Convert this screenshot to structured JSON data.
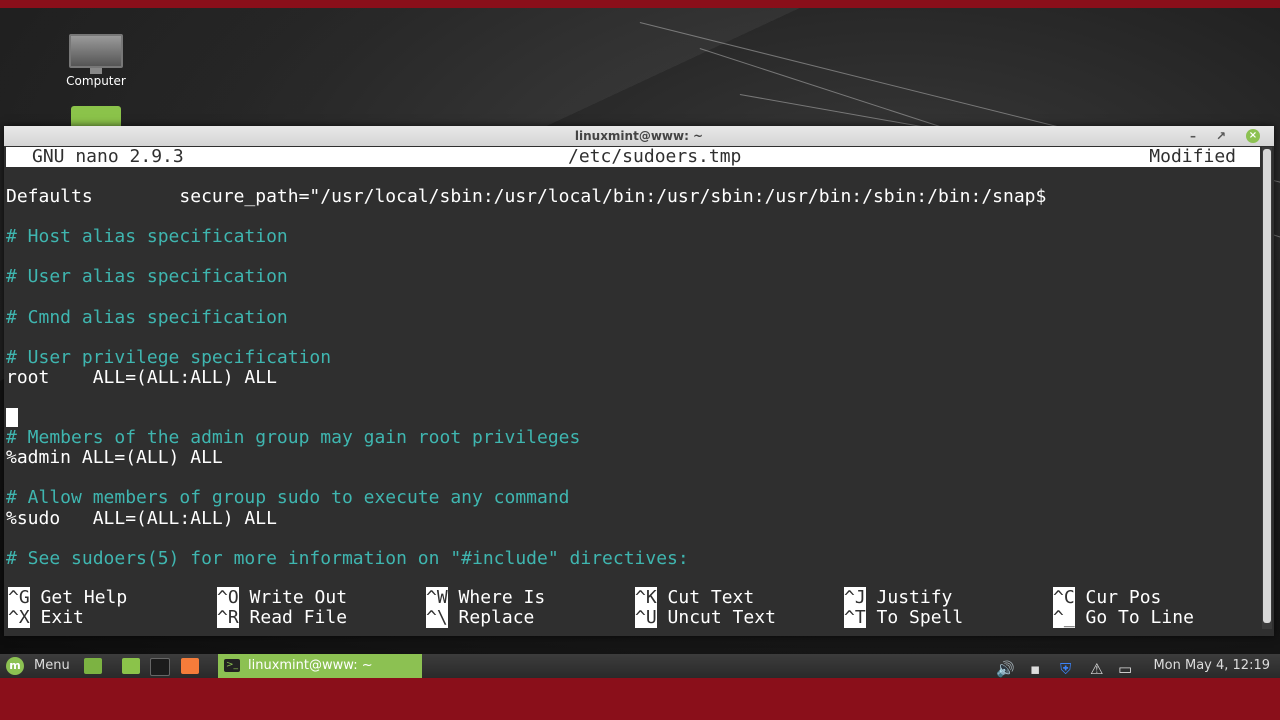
{
  "desktop": {
    "icons": [
      {
        "label": "Computer",
        "icon": "computer-icon"
      },
      {
        "label": "",
        "icon": "home-folder-icon"
      }
    ]
  },
  "window": {
    "title": "linuxmint@www: ~",
    "minimize": "–",
    "maximize": "↗",
    "close": "×"
  },
  "nano": {
    "version": "GNU nano 2.9.3",
    "filename": "/etc/sudoers.tmp",
    "status": "Modified"
  },
  "editor_lines": [
    {
      "text": "Defaults        secure_path=\"/usr/local/sbin:/usr/local/bin:/usr/sbin:/usr/bin:/sbin:/bin:/snap$",
      "kind": "code"
    },
    {
      "text": "",
      "kind": "blank"
    },
    {
      "text": "# Host alias specification",
      "kind": "comment"
    },
    {
      "text": "",
      "kind": "blank"
    },
    {
      "text": "# User alias specification",
      "kind": "comment"
    },
    {
      "text": "",
      "kind": "blank"
    },
    {
      "text": "# Cmnd alias specification",
      "kind": "comment"
    },
    {
      "text": "",
      "kind": "blank"
    },
    {
      "text": "# User privilege specification",
      "kind": "comment"
    },
    {
      "text": "root    ALL=(ALL:ALL) ALL",
      "kind": "code"
    },
    {
      "text": "",
      "kind": "blank"
    },
    {
      "text": "",
      "kind": "cursor"
    },
    {
      "text": "# Members of the admin group may gain root privileges",
      "kind": "comment"
    },
    {
      "text": "%admin ALL=(ALL) ALL",
      "kind": "code"
    },
    {
      "text": "",
      "kind": "blank"
    },
    {
      "text": "# Allow members of group sudo to execute any command",
      "kind": "comment"
    },
    {
      "text": "%sudo   ALL=(ALL:ALL) ALL",
      "kind": "code"
    },
    {
      "text": "",
      "kind": "blank"
    },
    {
      "text": "# See sudoers(5) for more information on \"#include\" directives:",
      "kind": "comment"
    }
  ],
  "shortcuts": [
    {
      "key": "^G",
      "label": "Get Help"
    },
    {
      "key": "^O",
      "label": "Write Out"
    },
    {
      "key": "^W",
      "label": "Where Is"
    },
    {
      "key": "^K",
      "label": "Cut Text"
    },
    {
      "key": "^J",
      "label": "Justify"
    },
    {
      "key": "^C",
      "label": "Cur Pos"
    },
    {
      "key": "^X",
      "label": "Exit"
    },
    {
      "key": "^R",
      "label": "Read File"
    },
    {
      "key": "^\\",
      "label": "Replace"
    },
    {
      "key": "^U",
      "label": "Uncut Text"
    },
    {
      "key": "^T",
      "label": "To Spell"
    },
    {
      "key": "^_",
      "label": "Go To Line"
    }
  ],
  "taskbar": {
    "menu_label": "Menu",
    "task_title": "linuxmint@www: ~",
    "clock": "Mon May 4, 12:19",
    "colors": {
      "accent": "#8cc152",
      "panel": "#2f2f2f"
    }
  }
}
